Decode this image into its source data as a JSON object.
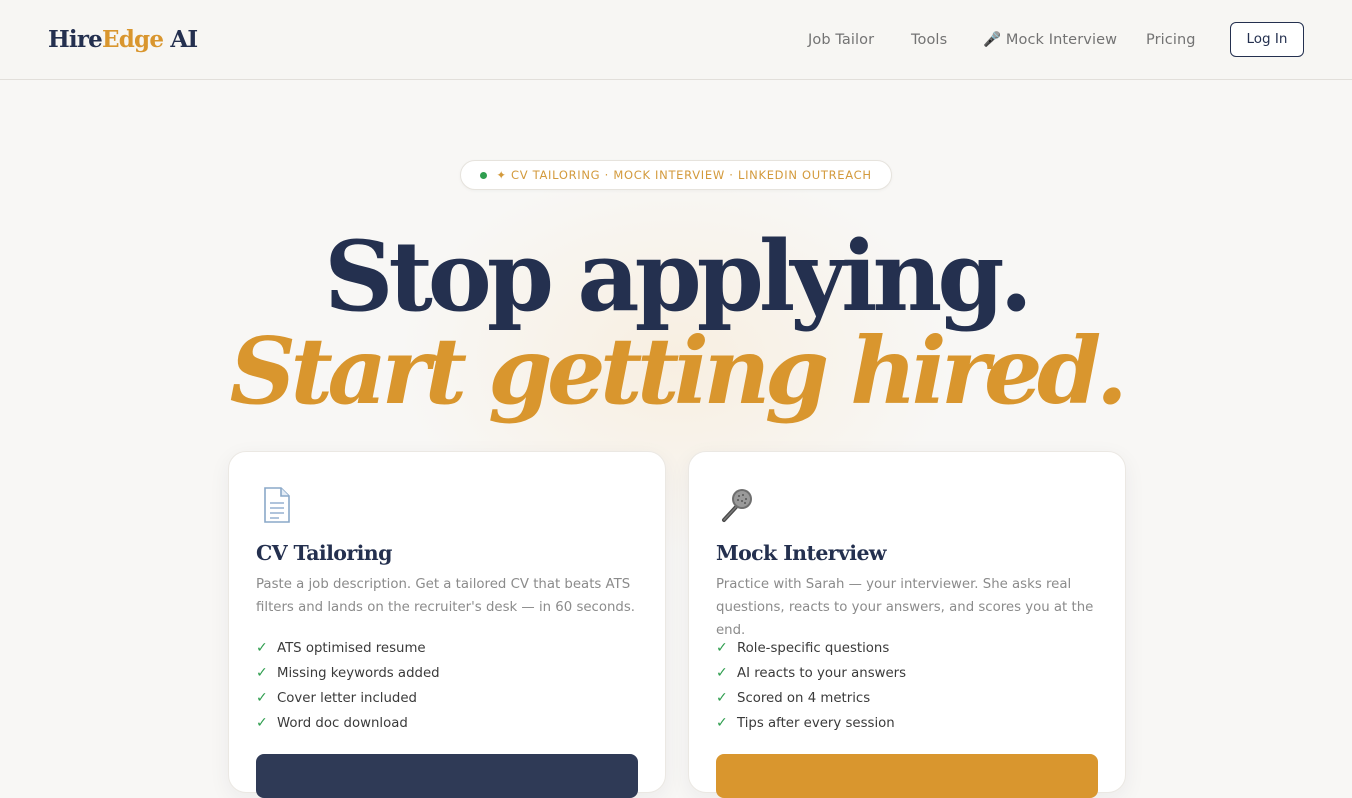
{
  "nav": {
    "logo_part1": "Hire",
    "logo_part2": "Edge",
    "logo_part3": " AI",
    "links": [
      "Job Tailor",
      "Tools",
      "🎤 Mock Interview",
      "Pricing"
    ],
    "login_label": "Log In"
  },
  "badge": {
    "text": "✦ CV TAILORING · MOCK INTERVIEW · LINKEDIN OUTREACH"
  },
  "hero": {
    "line1": "Stop applying.",
    "line2": "Start getting hired."
  },
  "cards": [
    {
      "icon": "document-icon",
      "title": "CV Tailoring",
      "description": "Paste a job description. Get a tailored CV that beats ATS filters and lands on the recruiter's desk — in 60 seconds.",
      "features": [
        "ATS optimised resume",
        "Missing keywords added",
        "Cover letter included",
        "Word doc download"
      ],
      "cta_label": ""
    },
    {
      "icon": "microphone-icon",
      "title": "Mock Interview",
      "description": "Practice with Sarah — your interviewer. She asks real questions, reacts to your answers, and scores you at the end.",
      "features": [
        "Role-specific questions",
        "AI reacts to your answers",
        "Scored on 4 metrics",
        "Tips after every session"
      ],
      "cta_label": ""
    }
  ],
  "colors": {
    "navy": "#24304f",
    "gold": "#d9962e",
    "green": "#2f9e4f",
    "background": "#f8f7f5"
  }
}
